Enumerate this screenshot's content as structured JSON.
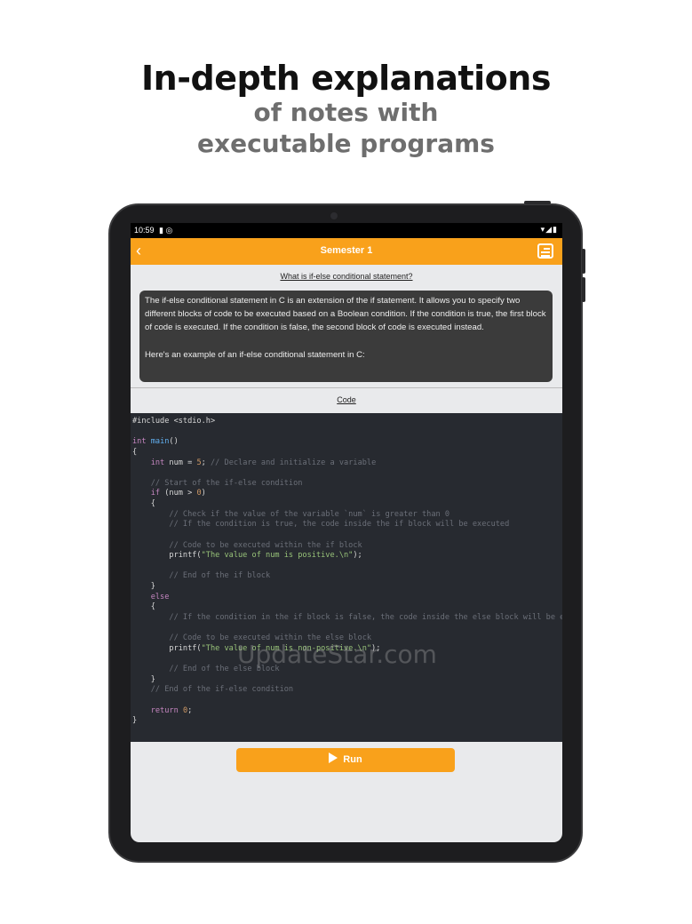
{
  "headline": {
    "line1": "In-depth explanations",
    "line2": "of notes with",
    "line3": "executable programs"
  },
  "statusbar": {
    "time": "10:59"
  },
  "appbar": {
    "back_icon": "chevron-left-icon",
    "title": "Semester 1",
    "menu_icon": "notes-menu-icon"
  },
  "question": "What is if-else conditional statement?",
  "explanation": {
    "paragraph1": "The if-else conditional statement in C is an extension of the if statement. It allows you to specify two different blocks of code to be executed based on a Boolean condition. If the condition is true, the first block of code is executed. If the condition is false, the second block of code is executed instead.",
    "paragraph2": "Here's an example of an if-else conditional statement in C:"
  },
  "code_label": "Code",
  "watermark": "UpdateStar.com",
  "run_button": {
    "label": "Run",
    "icon": "play-icon"
  },
  "colors": {
    "accent": "#f9a11b",
    "code_bg": "#272a30",
    "explanation_bg": "#3b3b3b"
  }
}
